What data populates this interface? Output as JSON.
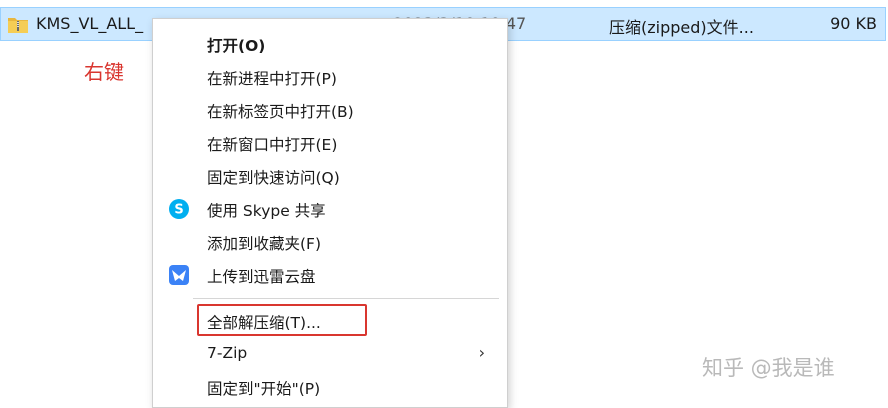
{
  "file_row": {
    "name": "KMS_VL_ALL_",
    "date": "2023/3/10 10:47",
    "type": "压缩(zipped)文件...",
    "size": "90 KB",
    "icon": "zip-folder-icon"
  },
  "annotation": "右键",
  "menu": {
    "items": [
      {
        "label": "打开(O)",
        "bold": true
      },
      {
        "label": "在新进程中打开(P)"
      },
      {
        "label": "在新标签页中打开(B)"
      },
      {
        "label": "在新窗口中打开(E)"
      },
      {
        "label": "固定到快速访问(Q)"
      },
      {
        "label": "使用 Skype 共享",
        "icon": "skype-icon"
      },
      {
        "label": "添加到收藏夹(F)"
      },
      {
        "label": "上传到迅雷云盘",
        "icon": "xunlei-icon"
      },
      {
        "label": "全部解压缩(T)...",
        "highlighted": true
      },
      {
        "label": "7-Zip",
        "submenu": "›"
      },
      {
        "label": "固定到\"开始\"(P)"
      }
    ]
  },
  "watermark": "知乎 @我是谁",
  "colors": {
    "selection_bg": "#cce8ff",
    "annotation_red": "#d9362f",
    "skype_blue": "#00aff0",
    "xunlei_blue": "#3b82f6"
  }
}
